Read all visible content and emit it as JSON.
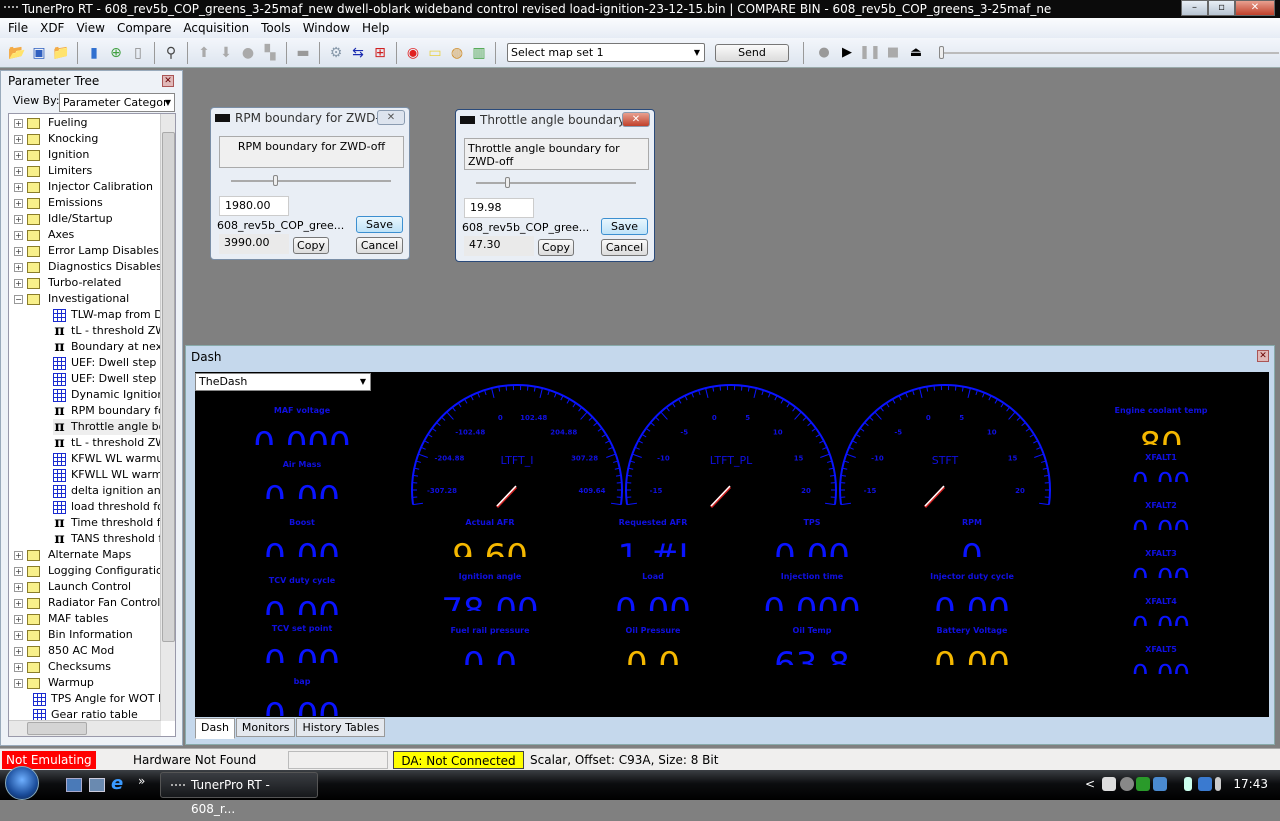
{
  "window": {
    "title": "TunerPro RT - 608_rev5b_COP_greens_3-25maf_new dwell-oblark wideband control revised load-ignition-23-12-15.bin | COMPARE BIN - 608_rev5b_COP_greens_3-25maf_ne",
    "controls": [
      "–",
      "▫",
      "✕"
    ]
  },
  "menu": [
    "File",
    "XDF",
    "View",
    "Compare",
    "Acquisition",
    "Tools",
    "Window",
    "Help"
  ],
  "toolbar": {
    "icons": [
      {
        "name": "open-folder-icon",
        "glyph": "📂",
        "color": "#e0a020"
      },
      {
        "name": "save-icon",
        "glyph": "▣",
        "color": "#3060c0"
      },
      {
        "name": "open-recent-icon",
        "glyph": "📁",
        "color": "#e0a020"
      },
      {
        "name": "sep"
      },
      {
        "name": "export-icon",
        "glyph": "▮",
        "color": "#3070d0"
      },
      {
        "name": "add-icon",
        "glyph": "⊕",
        "color": "#40a040"
      },
      {
        "name": "new-document-icon",
        "glyph": "▯",
        "color": "#888"
      },
      {
        "name": "sep"
      },
      {
        "name": "connect-cable-icon",
        "glyph": "⚲",
        "color": "#444"
      },
      {
        "name": "sep"
      },
      {
        "name": "up-arrow-icon",
        "glyph": "⬆",
        "color": "#aaa"
      },
      {
        "name": "down-arrow-icon",
        "glyph": "⬇",
        "color": "#aaa"
      },
      {
        "name": "circle-icon",
        "glyph": "●",
        "color": "#aaa"
      },
      {
        "name": "copy-icon",
        "glyph": "▚",
        "color": "#aaa"
      },
      {
        "name": "sep"
      },
      {
        "name": "chip-icon",
        "glyph": "▬",
        "color": "#999"
      },
      {
        "name": "sep"
      },
      {
        "name": "gears-icon",
        "glyph": "⚙",
        "color": "#8899aa"
      },
      {
        "name": "swap-arrows-icon",
        "glyph": "⇆",
        "color": "#1a2bb0"
      },
      {
        "name": "table-import-icon",
        "glyph": "⊞",
        "color": "#d02020"
      },
      {
        "name": "sep"
      },
      {
        "name": "emulator-icon",
        "glyph": "◉",
        "color": "#e02020"
      },
      {
        "name": "notes-icon",
        "glyph": "▭",
        "color": "#e8d040"
      },
      {
        "name": "info-icon",
        "glyph": "◍",
        "color": "#d09030"
      },
      {
        "name": "bar-chart-icon",
        "glyph": "▥",
        "color": "#40a040"
      },
      {
        "name": "sep"
      }
    ],
    "map_set": "Select map set 1",
    "send_label": "Send",
    "playback": [
      {
        "name": "record-icon",
        "glyph": "●",
        "color": "#999"
      },
      {
        "name": "play-icon",
        "glyph": "▶",
        "color": "#000"
      },
      {
        "name": "pause-icon",
        "glyph": "❚❚",
        "color": "#aaa"
      },
      {
        "name": "stop-icon",
        "glyph": "■",
        "color": "#aaa"
      },
      {
        "name": "eject-icon",
        "glyph": "⏏",
        "color": "#000"
      }
    ]
  },
  "tree": {
    "title": "Parameter Tree",
    "view_by_label": "View By:",
    "view_by_value": "Parameter Categor",
    "items": [
      {
        "label": "Fueling",
        "type": "folder"
      },
      {
        "label": "Knocking",
        "type": "folder"
      },
      {
        "label": "Ignition",
        "type": "folder"
      },
      {
        "label": "Limiters",
        "type": "folder"
      },
      {
        "label": "Injector Calibration",
        "type": "folder"
      },
      {
        "label": "Emissions",
        "type": "folder"
      },
      {
        "label": "Idle/Startup",
        "type": "folder"
      },
      {
        "label": "Axes",
        "type": "folder"
      },
      {
        "label": "Error Lamp Disables (y",
        "type": "folder"
      },
      {
        "label": "Diagnostics Disables",
        "type": "folder"
      },
      {
        "label": "Turbo-related",
        "type": "folder"
      },
      {
        "label": "Investigational",
        "type": "folder-open"
      },
      {
        "label": "TLW-map from DK-",
        "type": "table",
        "child": true
      },
      {
        "label": "tL - threshold ZWB",
        "type": "scalar",
        "child": true
      },
      {
        "label": "Boundary at next",
        "type": "scalar",
        "child": true
      },
      {
        "label": "UEF: Dwell step wi",
        "type": "table",
        "child": true
      },
      {
        "label": "UEF: Dwell step wi",
        "type": "table",
        "child": true
      },
      {
        "label": "Dynamic Ignition R",
        "type": "table",
        "child": true
      },
      {
        "label": "RPM boundary for",
        "type": "scalar",
        "child": true
      },
      {
        "label": "Throttle angle bou",
        "type": "scalar",
        "child": true,
        "selected": true
      },
      {
        "label": "tL - threshold ZWB",
        "type": "scalar",
        "child": true
      },
      {
        "label": "KFWL WL warmup",
        "type": "table",
        "child": true
      },
      {
        "label": "KFWLL WL warmup",
        "type": "table",
        "child": true
      },
      {
        "label": "delta ignition angle",
        "type": "table",
        "child": true
      },
      {
        "label": "load threshold for",
        "type": "table",
        "child": true
      },
      {
        "label": "Time threshold for",
        "type": "scalar",
        "child": true
      },
      {
        "label": "TANS threshold for",
        "type": "scalar",
        "child": true
      },
      {
        "label": "Alternate Maps",
        "type": "folder"
      },
      {
        "label": "Logging Configuration",
        "type": "folder"
      },
      {
        "label": "Launch Control",
        "type": "folder"
      },
      {
        "label": "Radiator Fan Control",
        "type": "folder"
      },
      {
        "label": "MAF tables",
        "type": "folder"
      },
      {
        "label": "Bin Information",
        "type": "folder"
      },
      {
        "label": "850 AC Mod",
        "type": "folder"
      },
      {
        "label": "Checksums",
        "type": "folder"
      },
      {
        "label": "Warmup",
        "type": "folder"
      },
      {
        "label": "TPS Angle for WOT De",
        "type": "table",
        "root": true
      },
      {
        "label": "Gear ratio table",
        "type": "table",
        "root": true
      }
    ]
  },
  "dialogs": [
    {
      "title": "RPM boundary for ZWD-...",
      "description": "RPM boundary for ZWD-off",
      "value": "1980.00",
      "compare_name": "608_rev5b_COP_gree...",
      "compare_value": "3990.00",
      "slider_fraction": 0.26,
      "save": "Save",
      "copy": "Copy",
      "cancel": "Cancel"
    },
    {
      "title": "Throttle angle boundary ...",
      "description": "Throttle angle boundary for ZWD-off",
      "value": "19.98",
      "compare_name": "608_rev5b_COP_gree...",
      "compare_value": "47.30",
      "slider_fraction": 0.18,
      "save": "Save",
      "copy": "Copy",
      "cancel": "Cancel"
    }
  ],
  "dash": {
    "title": "Dash",
    "selector": "TheDash",
    "colors": {
      "label": "#1010e0",
      "normal": "#0a14ff",
      "warn": "#f5b800",
      "needle": "#ffffff"
    },
    "gauges": [
      {
        "label": "LTFT_I",
        "ticks": [
          "-307.28",
          "-204.88",
          "-102.48",
          "0",
          "102.48",
          "204.88",
          "307.28",
          "409.64"
        ]
      },
      {
        "label": "LTFT_PL",
        "ticks": [
          "-15",
          "-10",
          "-5",
          "0",
          "5",
          "10",
          "15",
          "20"
        ]
      },
      {
        "label": "STFT",
        "ticks": [
          "-15",
          "-10",
          "-5",
          "0",
          "5",
          "10",
          "15",
          "20"
        ]
      }
    ],
    "readouts": [
      {
        "label": "MAF voltage",
        "value": "0.000",
        "state": "normal"
      },
      {
        "label": "Air Mass",
        "value": "0.00",
        "state": "normal"
      },
      {
        "label": "Boost",
        "value": "0.00",
        "state": "normal"
      },
      {
        "label": "TCV duty cycle",
        "value": "0.00",
        "state": "normal"
      },
      {
        "label": "TCV set point",
        "value": "0.00",
        "state": "normal"
      },
      {
        "label": "bap",
        "value": "0.00",
        "state": "normal"
      },
      {
        "label": "Actual AFR",
        "value": "9.60",
        "state": "warn"
      },
      {
        "label": "Ignition angle",
        "value": "78.00",
        "state": "normal"
      },
      {
        "label": "Fuel rail pressure",
        "value": "0.0",
        "state": "normal"
      },
      {
        "label": "Requested AFR",
        "value": "1.#I",
        "state": "normal"
      },
      {
        "label": "Load",
        "value": "0.00",
        "state": "normal"
      },
      {
        "label": "Oil Pressure",
        "value": "0.0",
        "state": "warn"
      },
      {
        "label": "TPS",
        "value": "0.00",
        "state": "normal"
      },
      {
        "label": "Injection time",
        "value": "0.000",
        "state": "normal"
      },
      {
        "label": "Oil Temp",
        "value": "63.8",
        "state": "normal"
      },
      {
        "label": "RPM",
        "value": "0",
        "state": "normal"
      },
      {
        "label": "Injector duty cycle",
        "value": "0.00",
        "state": "normal"
      },
      {
        "label": "Battery Voltage",
        "value": "0.00",
        "state": "warn"
      },
      {
        "label": "Engine coolant temp",
        "value": "80",
        "state": "warn"
      },
      {
        "label": "XFALT1",
        "value": "0.00",
        "state": "normal"
      },
      {
        "label": "XFALT2",
        "value": "0.00",
        "state": "normal"
      },
      {
        "label": "XFALT3",
        "value": "0.00",
        "state": "normal"
      },
      {
        "label": "XFALT4",
        "value": "0.00",
        "state": "normal"
      },
      {
        "label": "XFALT5",
        "value": "0.00",
        "state": "normal"
      }
    ],
    "tabs": [
      "Dash",
      "Monitors",
      "History Tables"
    ]
  },
  "status": {
    "emulation": "Not Emulating",
    "hardware": "Hardware Not Found",
    "da": "DA: Not Connected",
    "info": "Scalar, Offset: C93A,  Size: 8 Bit",
    "colors": {
      "emulation_bg": "#ff0000",
      "da_bg": "#ffff00"
    }
  },
  "taskbar": {
    "task": "TunerPro RT - 608_r...",
    "overflow": "»",
    "tray_expand": "<",
    "clock": "17:43"
  }
}
